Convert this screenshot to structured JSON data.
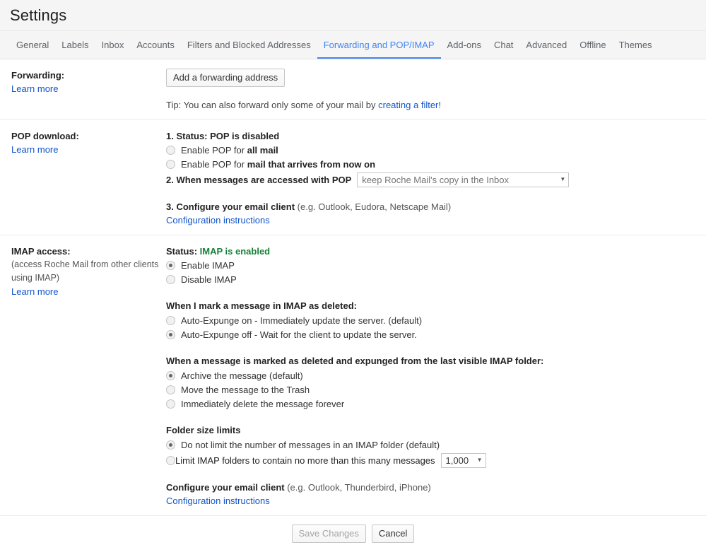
{
  "header": {
    "title": "Settings"
  },
  "tabs": [
    {
      "label": "General",
      "active": false
    },
    {
      "label": "Labels",
      "active": false
    },
    {
      "label": "Inbox",
      "active": false
    },
    {
      "label": "Accounts",
      "active": false
    },
    {
      "label": "Filters and Blocked Addresses",
      "active": false
    },
    {
      "label": "Forwarding and POP/IMAP",
      "active": true
    },
    {
      "label": "Add-ons",
      "active": false
    },
    {
      "label": "Chat",
      "active": false
    },
    {
      "label": "Advanced",
      "active": false
    },
    {
      "label": "Offline",
      "active": false
    },
    {
      "label": "Themes",
      "active": false
    }
  ],
  "forwarding": {
    "label": "Forwarding:",
    "learn_more": "Learn more",
    "add_button": "Add a forwarding address",
    "tip_prefix": "Tip: You can also forward only some of your mail by ",
    "tip_link": "creating a filter!"
  },
  "pop": {
    "label": "POP download:",
    "learn_more": "Learn more",
    "status_line": "1. Status: POP is disabled",
    "option_all_prefix": "Enable POP for ",
    "option_all_bold": "all mail",
    "option_now_prefix": "Enable POP for ",
    "option_now_bold": "mail that arrives from now on",
    "accessed_label": "2. When messages are accessed with POP",
    "accessed_value": "keep Roche Mail's copy in the Inbox",
    "configure_bold": "3. Configure your email client",
    "configure_rest": " (e.g. Outlook, Eudora, Netscape Mail)",
    "configure_link": "Configuration instructions"
  },
  "imap": {
    "label": "IMAP access:",
    "sub_line1": "(access Roche Mail from other clients",
    "sub_line2": "using IMAP)",
    "learn_more": "Learn more",
    "status_prefix": "Status: ",
    "status_value": "IMAP is enabled",
    "enable_label": "Enable IMAP",
    "disable_label": "Disable IMAP",
    "expunge_title": "When I mark a message in IMAP as deleted:",
    "expunge_on": "Auto-Expunge on - Immediately update the server. (default)",
    "expunge_off": "Auto-Expunge off - Wait for the client to update the server.",
    "deleted_title": "When a message is marked as deleted and expunged from the last visible IMAP folder:",
    "deleted_archive": "Archive the message (default)",
    "deleted_trash": "Move the message to the Trash",
    "deleted_forever": "Immediately delete the message forever",
    "folder_title": "Folder size limits",
    "folder_nolimit": "Do not limit the number of messages in an IMAP folder (default)",
    "folder_limit": "Limit IMAP folders to contain no more than this many messages",
    "folder_limit_value": "1,000",
    "configure_bold": "Configure your email client",
    "configure_rest": " (e.g. Outlook, Thunderbird, iPhone)",
    "configure_link": "Configuration instructions"
  },
  "footer": {
    "save_label": "Save Changes",
    "cancel_label": "Cancel"
  },
  "colors": {
    "accent": "#4285f4",
    "link": "#1155cc",
    "success": "#188038"
  }
}
